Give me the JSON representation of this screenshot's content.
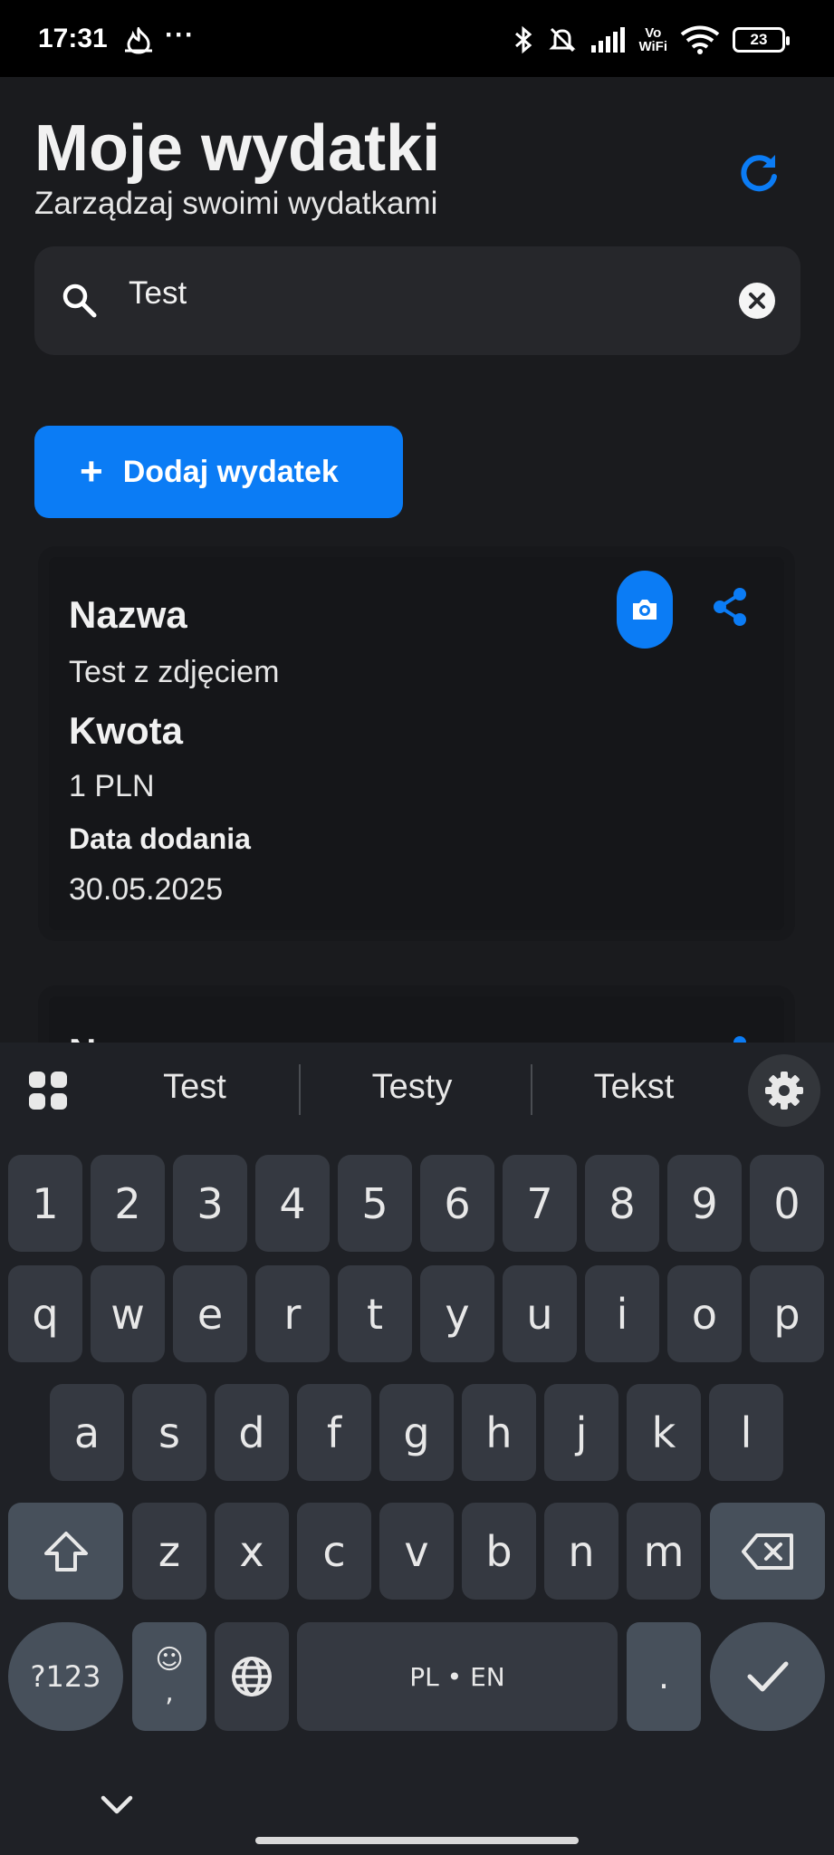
{
  "status_bar": {
    "time": "17:31",
    "dots": "···",
    "vowifi_top": "Vo",
    "vowifi_bottom": "WiFi",
    "battery": "23"
  },
  "header": {
    "title": "Moje wydatki",
    "subtitle": "Zarządzaj swoimi wydatkami",
    "refresh_icon": "refresh-icon"
  },
  "search": {
    "value": "Test",
    "placeholder": ""
  },
  "add_button": {
    "plus": "+",
    "label": "Dodaj wydatek"
  },
  "expenses": [
    {
      "name_label": "Nazwa",
      "name": "Test z zdjęciem",
      "amount_label": "Kwota",
      "amount": "1 PLN",
      "date_label": "Data dodania",
      "date": "30.05.2025"
    },
    {
      "name_label": "N"
    }
  ],
  "keyboard": {
    "suggestions": [
      "Test",
      "Testy",
      "Tekst"
    ],
    "row_numbers": [
      "1",
      "2",
      "3",
      "4",
      "5",
      "6",
      "7",
      "8",
      "9",
      "0"
    ],
    "row_top": [
      "q",
      "w",
      "e",
      "r",
      "t",
      "y",
      "u",
      "i",
      "o",
      "p"
    ],
    "row_mid": [
      "a",
      "s",
      "d",
      "f",
      "g",
      "h",
      "j",
      "k",
      "l"
    ],
    "row_bottom": [
      "z",
      "x",
      "c",
      "v",
      "b",
      "n",
      "m"
    ],
    "symbols_key": "?123",
    "emoji_key": "☺",
    "comma_key": ",",
    "space_key": "PL • EN",
    "period_key": "."
  },
  "colors": {
    "accent": "#0b7cf5",
    "background": "#1a1b1e",
    "card": "#151619"
  }
}
